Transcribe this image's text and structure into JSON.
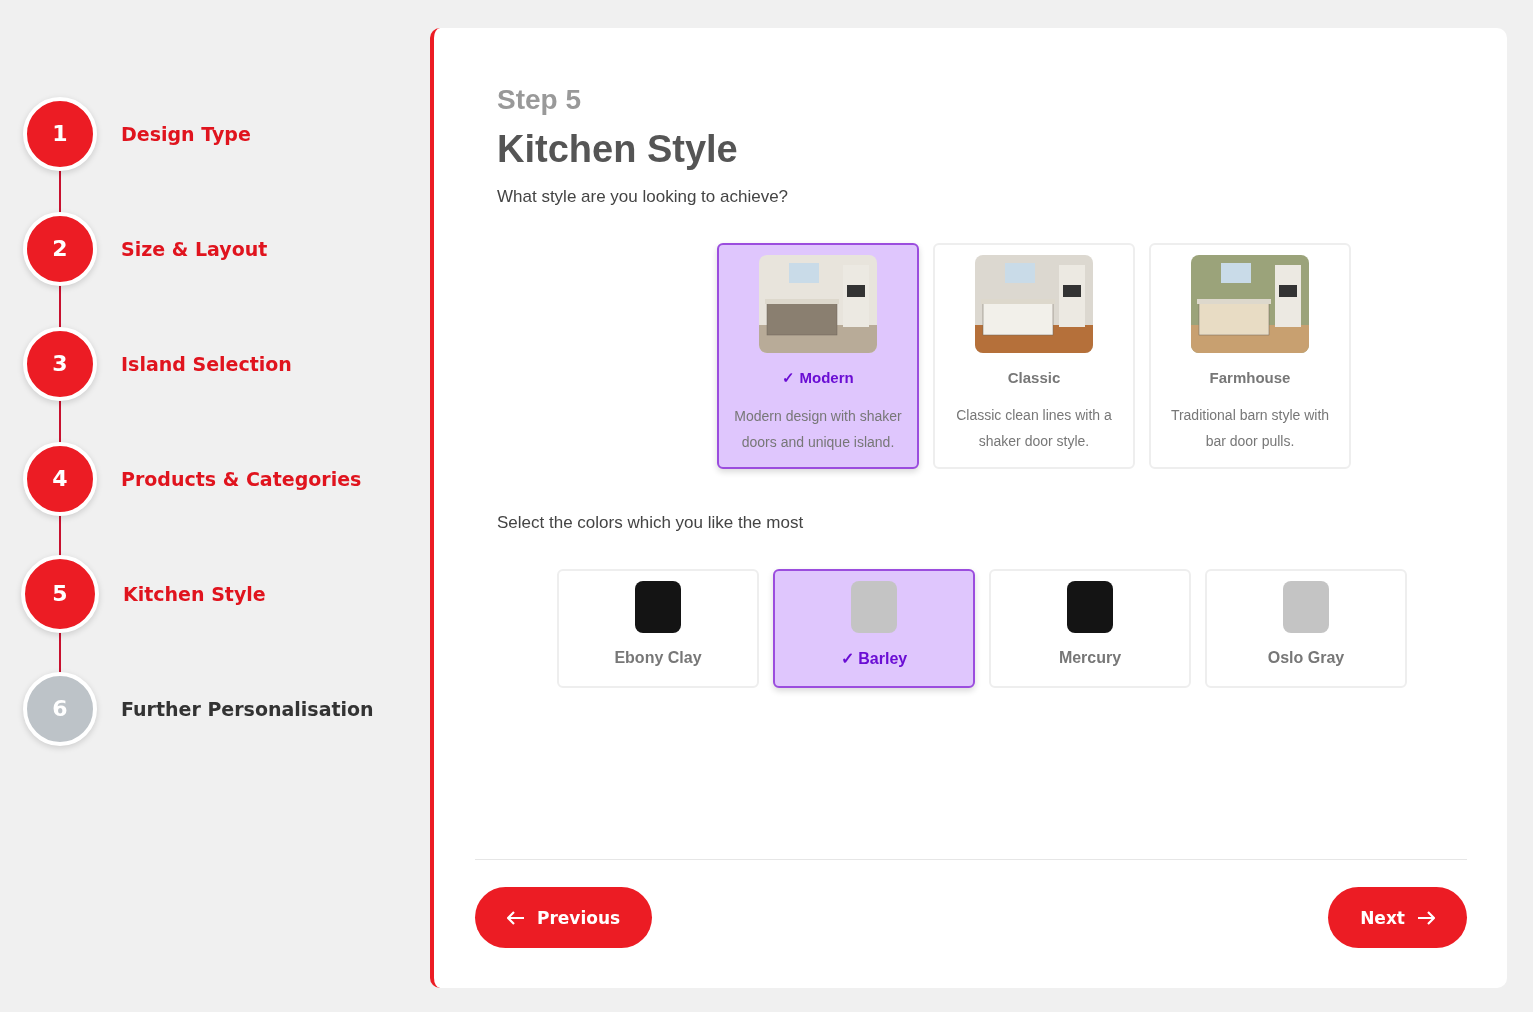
{
  "steps": [
    {
      "number": "1",
      "label": "Design Type",
      "done": true,
      "selected": false
    },
    {
      "number": "2",
      "label": "Size & Layout",
      "done": true,
      "selected": false
    },
    {
      "number": "3",
      "label": "Island Selection",
      "done": true,
      "selected": false
    },
    {
      "number": "4",
      "label": "Products & Categories",
      "done": true,
      "selected": false
    },
    {
      "number": "5",
      "label": "Kitchen Style",
      "done": true,
      "selected": true
    },
    {
      "number": "6",
      "label": "Further Personalisation",
      "done": false,
      "selected": false
    }
  ],
  "selected_mark": "✓",
  "step_label": "Step 5",
  "title": "Kitchen Style",
  "question": "What style are you looking to achieve?",
  "styles": [
    {
      "name": "Modern",
      "description": "Modern design with shaker doors and unique island.",
      "selected": true
    },
    {
      "name": "Classic",
      "description": "Classic clean lines with a shaker door style.",
      "selected": false
    },
    {
      "name": "Farmhouse",
      "description": "Traditional barn style with bar door pulls.",
      "selected": false
    }
  ],
  "colors_question": "Select the colors which you like the most",
  "colors": [
    {
      "name": "Ebony Clay",
      "color": "#141414",
      "selected": false
    },
    {
      "name": "Barley",
      "color": "#c4c4c4",
      "selected": true
    },
    {
      "name": "Mercury",
      "color": "#141414",
      "selected": false
    },
    {
      "name": "Oslo Gray",
      "color": "#c4c4c4",
      "selected": false
    }
  ],
  "buttons": {
    "previous": "Previous",
    "next": "Next"
  }
}
